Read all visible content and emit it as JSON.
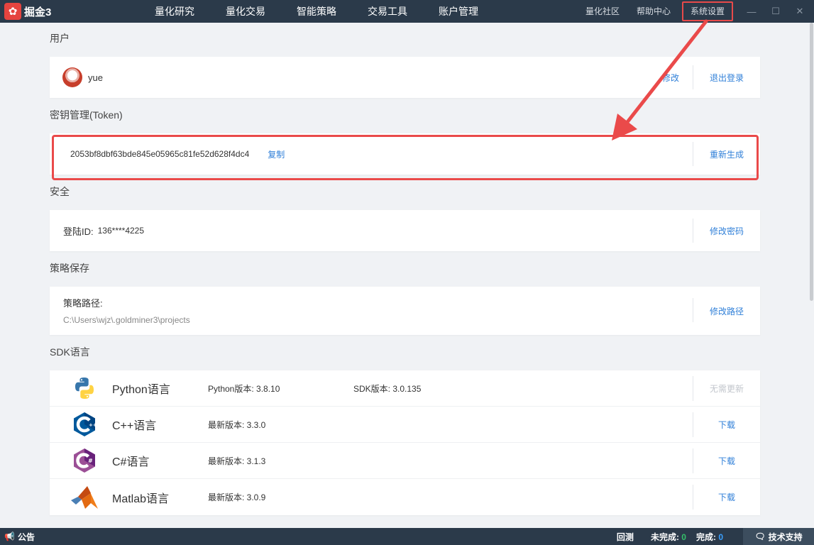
{
  "app": {
    "logo_symbol": "✿",
    "logo_text": "掘金3"
  },
  "nav": [
    "量化研究",
    "量化交易",
    "智能策略",
    "交易工具",
    "账户管理"
  ],
  "right_nav": {
    "community": "量化社区",
    "help": "帮助中心",
    "settings": "系统设置"
  },
  "window_controls": {
    "minimize": "—",
    "maximize": "☐",
    "close": "✕"
  },
  "user": {
    "title": "用户",
    "name": "yue",
    "edit_label": "修改",
    "logout_label": "退出登录"
  },
  "token": {
    "title": "密钥管理(Token)",
    "value": "2053bf8dbf63bde845e05965c81fe52d628f4dc4",
    "copy_label": "复制",
    "regenerate_label": "重新生成"
  },
  "security": {
    "title": "安全",
    "login_label": "登陆ID:",
    "login_value": "136****4225",
    "change_password_label": "修改密码"
  },
  "strategy_save": {
    "title": "策略保存",
    "path_label": "策略路径:",
    "path_value": "C:\\Users\\wjz\\.goldminer3\\projects",
    "change_path_label": "修改路径"
  },
  "sdk": {
    "title": "SDK语言",
    "languages": [
      {
        "name": "Python语言",
        "version": "Python版本: 3.8.10",
        "sdk_version": "SDK版本: 3.0.135",
        "action": "无需更新",
        "icon": "python-icon"
      },
      {
        "name": "C++语言",
        "version": "最新版本: 3.3.0",
        "sdk_version": "",
        "action": "下载",
        "icon": "cpp-icon"
      },
      {
        "name": "C#语言",
        "version": "最新版本: 3.1.3",
        "sdk_version": "",
        "action": "下载",
        "icon": "csharp-icon"
      },
      {
        "name": "Matlab语言",
        "version": "最新版本: 3.0.9",
        "sdk_version": "",
        "action": "下载",
        "icon": "matlab-icon"
      }
    ]
  },
  "statusbar": {
    "notice_icon": "📢",
    "notice": "公告",
    "backtest": "回测",
    "incomplete_label": "未完成:",
    "incomplete_value": "0",
    "complete_label": "完成:",
    "complete_value": "0",
    "support_icon": "🗨",
    "support": "技术支持"
  },
  "colors": {
    "topbar": "#2b3a4a",
    "link": "#2f7fd8",
    "highlight": "#ea4a4a",
    "page_bg": "#f0f2f5"
  }
}
